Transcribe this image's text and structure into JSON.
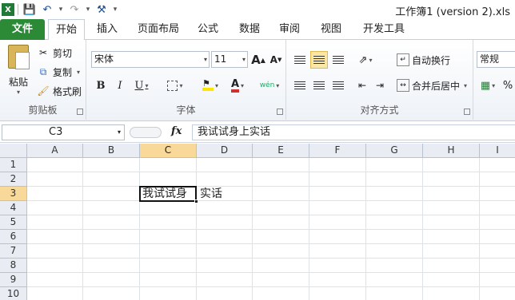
{
  "window": {
    "title": "工作簿1 (version 2).xls"
  },
  "qat": {
    "save_icon": "save-icon",
    "undo_icon": "undo-icon",
    "redo_icon": "redo-icon",
    "customize_icon": "tools-icon"
  },
  "tabs": [
    {
      "label": "文件"
    },
    {
      "label": "开始"
    },
    {
      "label": "插入"
    },
    {
      "label": "页面布局"
    },
    {
      "label": "公式"
    },
    {
      "label": "数据"
    },
    {
      "label": "审阅"
    },
    {
      "label": "视图"
    },
    {
      "label": "开发工具"
    }
  ],
  "ribbon": {
    "clipboard": {
      "paste": "粘贴",
      "cut": "剪切",
      "copy": "复制",
      "format_painter": "格式刷",
      "group_label": "剪贴板"
    },
    "font": {
      "font_name": "宋体",
      "font_size": "11",
      "bold": "B",
      "italic": "I",
      "underline": "U",
      "font_color": "A",
      "phonetic": "wén",
      "grow": "A",
      "shrink": "A",
      "group_label": "字体"
    },
    "alignment": {
      "wrap_text": "自动换行",
      "merge_center": "合并后居中",
      "group_label": "对齐方式"
    },
    "number": {
      "format": "常规",
      "percent": "%"
    }
  },
  "formula_bar": {
    "name_box": "C3",
    "fx": "fx",
    "content": "我试试身上实话"
  },
  "sheet": {
    "columns": [
      "A",
      "B",
      "C",
      "D",
      "E",
      "F",
      "G",
      "H",
      "I"
    ],
    "rows": [
      "1",
      "2",
      "3",
      "4",
      "5",
      "6",
      "7",
      "8",
      "9",
      "10"
    ],
    "selected_column": "C",
    "selected_row": "3",
    "cell_c3_visible": "我试试身",
    "cell_c3_overflow": "实话"
  },
  "colors": {
    "file_tab": "#2c8a37",
    "selection_header": "#f9d99a",
    "accent_red": "#d32f2f"
  }
}
